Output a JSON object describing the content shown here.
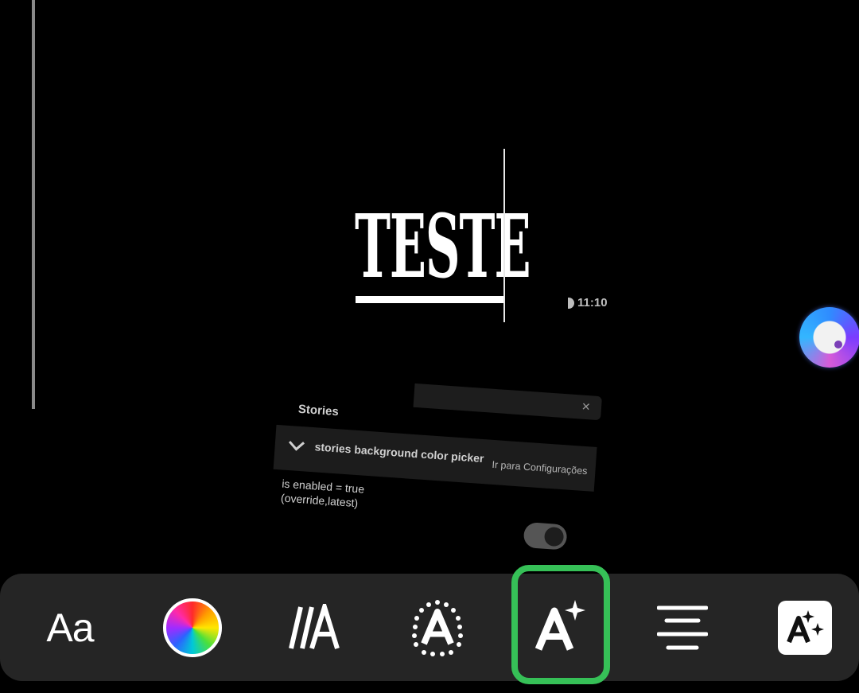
{
  "canvas": {
    "story_text": "TESTE",
    "time": "11:10"
  },
  "dev_panel": {
    "section": "Stories",
    "flag_name": "stories background color picker",
    "goto_link": "Ir para Configurações",
    "status_line1": "is enabled = true",
    "status_line2": "(override,latest)",
    "close_symbol": "×",
    "toggle_on": true
  },
  "toolbar": {
    "font_label": "Aa",
    "items": [
      {
        "name": "font-style",
        "icon": "aa-text-icon"
      },
      {
        "name": "text-color",
        "icon": "color-wheel-icon"
      },
      {
        "name": "text-animation",
        "icon": "slash-a-icon"
      },
      {
        "name": "text-effects",
        "icon": "dotted-a-icon"
      },
      {
        "name": "ai-text-style",
        "icon": "a-sparkle-icon",
        "selected": true
      },
      {
        "name": "text-align",
        "icon": "align-center-icon"
      },
      {
        "name": "text-background",
        "icon": "boxed-a-sparkle-icon"
      }
    ],
    "selected_color": "#36c057"
  }
}
